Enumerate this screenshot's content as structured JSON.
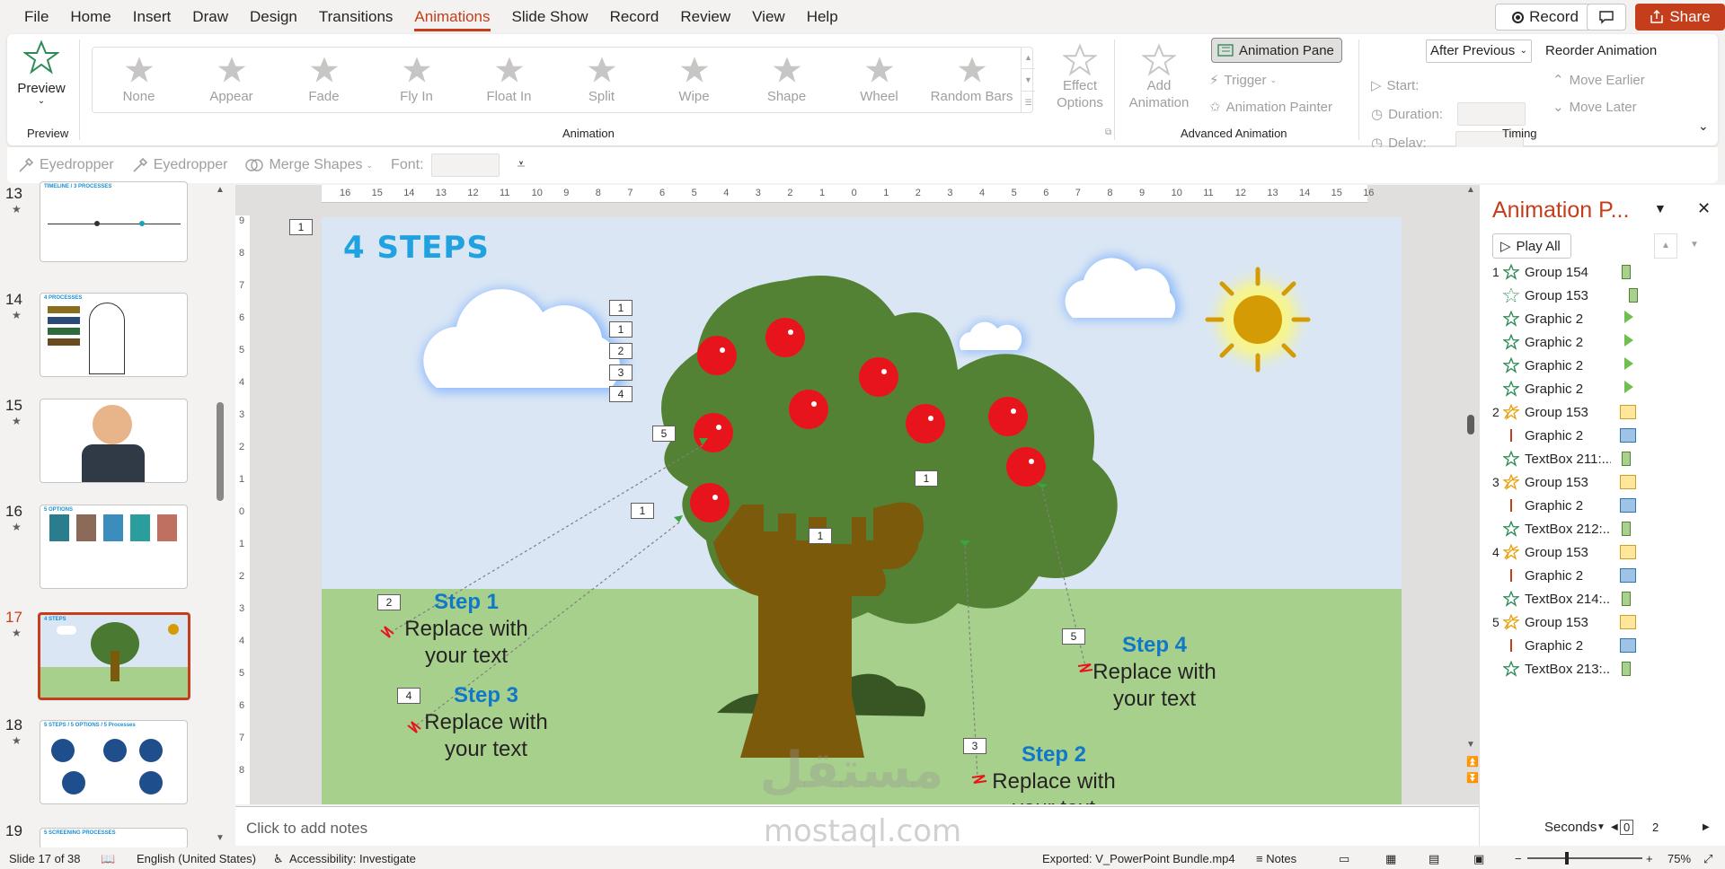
{
  "menu": [
    "File",
    "Home",
    "Insert",
    "Draw",
    "Design",
    "Transitions",
    "Animations",
    "Slide Show",
    "Record",
    "Review",
    "View",
    "Help"
  ],
  "active_menu": "Animations",
  "top_buttons": {
    "record": "Record",
    "share": "Share"
  },
  "ribbon": {
    "preview": "Preview",
    "preview_group": "Preview",
    "animations": [
      "None",
      "Appear",
      "Fade",
      "Fly In",
      "Float In",
      "Split",
      "Wipe",
      "Shape",
      "Wheel",
      "Random Bars"
    ],
    "effect_options": [
      "Effect",
      "Options"
    ],
    "animation_group": "Animation",
    "add_animation": [
      "Add",
      "Animation"
    ],
    "animation_pane": "Animation Pane",
    "trigger": "Trigger",
    "animation_painter": "Animation Painter",
    "advanced_group": "Advanced Animation",
    "start_label": "Start:",
    "start_value": "After Previous",
    "duration_label": "Duration:",
    "delay_label": "Delay:",
    "reorder": "Reorder Animation",
    "move_earlier": "Move Earlier",
    "move_later": "Move Later",
    "timing_group": "Timing"
  },
  "qat": {
    "eyedropper1": "Eyedropper",
    "eyedropper2": "Eyedropper",
    "merge_shapes": "Merge Shapes",
    "font_label": "Font:"
  },
  "thumbnails": [
    {
      "num": "13",
      "title": "TIMELINE / 3 PROCESSES"
    },
    {
      "num": "14",
      "title": "4 PROCESSES"
    },
    {
      "num": "15",
      "title": ""
    },
    {
      "num": "16",
      "title": "5 OPTIONS"
    },
    {
      "num": "17",
      "title": "4 STEPS"
    },
    {
      "num": "18",
      "title": "5 STEPS / 5 OPTIONS / 5 Processes"
    },
    {
      "num": "19",
      "title": "5 SCREENING PROCESSES"
    }
  ],
  "slide": {
    "title": "4 STEPS",
    "steps": [
      {
        "title": "Step 1",
        "text1": "Replace with",
        "text2": "your text"
      },
      {
        "title": "Step 2",
        "text1": "Replace with",
        "text2": "your text"
      },
      {
        "title": "Step 3",
        "text1": "Replace with",
        "text2": "your text"
      },
      {
        "title": "Step 4",
        "text1": "Replace with",
        "text2": "your text"
      }
    ],
    "tags": [
      "1",
      "1",
      "2",
      "3",
      "4",
      "5",
      "1",
      "1",
      "1",
      "2",
      "3",
      "4",
      "5"
    ]
  },
  "notes_placeholder": "Click to add notes",
  "anim_pane": {
    "title": "Animation P...",
    "play_all": "Play All",
    "items": [
      {
        "num": "1",
        "type": "green",
        "name": "Group 154",
        "bar": "green"
      },
      {
        "num": "",
        "type": "green2",
        "name": "Group 153",
        "bar": "green"
      },
      {
        "num": "",
        "type": "green",
        "name": "Graphic 2",
        "bar": "arrow"
      },
      {
        "num": "",
        "type": "green",
        "name": "Graphic 2",
        "bar": "arrow"
      },
      {
        "num": "",
        "type": "green",
        "name": "Graphic 2",
        "bar": "arrow"
      },
      {
        "num": "",
        "type": "green",
        "name": "Graphic 2",
        "bar": "arrow"
      },
      {
        "num": "2",
        "type": "path",
        "name": "Group 153",
        "bar": "yellow"
      },
      {
        "num": "",
        "type": "line",
        "name": "Graphic 2",
        "bar": "blue"
      },
      {
        "num": "",
        "type": "green",
        "name": "TextBox 211:...",
        "bar": "green"
      },
      {
        "num": "3",
        "type": "path",
        "name": "Group 153",
        "bar": "yellow"
      },
      {
        "num": "",
        "type": "line",
        "name": "Graphic 2",
        "bar": "blue"
      },
      {
        "num": "",
        "type": "green",
        "name": "TextBox 212:...",
        "bar": "green"
      },
      {
        "num": "4",
        "type": "path",
        "name": "Group 153",
        "bar": "yellow"
      },
      {
        "num": "",
        "type": "line",
        "name": "Graphic 2",
        "bar": "blue"
      },
      {
        "num": "",
        "type": "green",
        "name": "TextBox 214:...",
        "bar": "green"
      },
      {
        "num": "5",
        "type": "path",
        "name": "Group 153",
        "bar": "yellow"
      },
      {
        "num": "",
        "type": "line",
        "name": "Graphic 2",
        "bar": "blue"
      },
      {
        "num": "",
        "type": "green",
        "name": "TextBox 213:...",
        "bar": "green"
      }
    ],
    "seconds": "Seconds",
    "scale_start": "0",
    "scale_end": "2"
  },
  "status": {
    "slide_info": "Slide 17 of 38",
    "language": "English (United States)",
    "accessibility": "Accessibility: Investigate",
    "exported": "Exported: V_PowerPoint Bundle.mp4",
    "notes": "Notes",
    "zoom": "75%"
  },
  "watermark": [
    "مستقل",
    "mostaql.com"
  ],
  "colors": {
    "accent": "#c43e1c",
    "title_blue": "#1fa2df",
    "step_blue": "#1177c7",
    "apple_red": "#e8141c",
    "tree_green": "#4a7a32",
    "trunk": "#7b5a0b",
    "sky": "#dae6f4",
    "grass": "#a8d08d"
  }
}
